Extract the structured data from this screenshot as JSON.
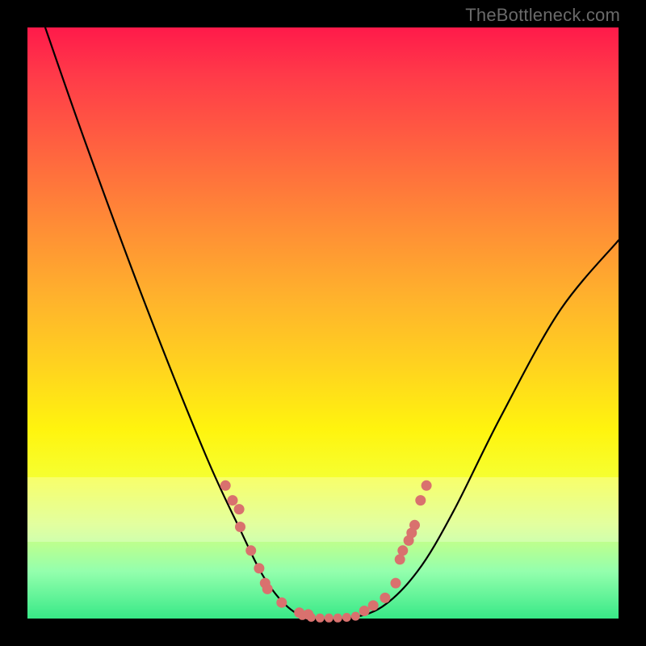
{
  "attribution": "TheBottleneck.com",
  "chart_data": {
    "type": "line",
    "title": "",
    "xlabel": "",
    "ylabel": "",
    "xlim": [
      0,
      100
    ],
    "ylim": [
      0,
      100
    ],
    "series": [
      {
        "name": "curve",
        "x": [
          3,
          10,
          20,
          30,
          36,
          40,
          44,
          48,
          54,
          60,
          66,
          72,
          80,
          90,
          100
        ],
        "y": [
          100,
          80,
          53,
          28,
          15,
          7,
          2,
          0,
          0,
          2,
          8,
          18,
          34,
          52,
          64
        ]
      }
    ],
    "markers": {
      "left_cluster": [
        {
          "x": 33.5,
          "y": 22.5
        },
        {
          "x": 34.7,
          "y": 20.0
        },
        {
          "x": 35.8,
          "y": 18.5
        },
        {
          "x": 36.0,
          "y": 15.5
        },
        {
          "x": 37.8,
          "y": 11.5
        },
        {
          "x": 39.2,
          "y": 8.5
        },
        {
          "x": 40.2,
          "y": 6.0
        },
        {
          "x": 40.6,
          "y": 5.0
        },
        {
          "x": 43.0,
          "y": 2.7
        },
        {
          "x": 46.0,
          "y": 1.0
        },
        {
          "x": 47.5,
          "y": 0.7
        }
      ],
      "bottom_cluster": [
        {
          "x": 46.5,
          "y": 0.5
        },
        {
          "x": 48.0,
          "y": 0.2
        },
        {
          "x": 49.5,
          "y": 0.1
        },
        {
          "x": 51.0,
          "y": 0.1
        },
        {
          "x": 52.5,
          "y": 0.1
        },
        {
          "x": 54.0,
          "y": 0.2
        },
        {
          "x": 55.5,
          "y": 0.4
        }
      ],
      "right_cluster": [
        {
          "x": 57.0,
          "y": 1.3
        },
        {
          "x": 58.5,
          "y": 2.2
        },
        {
          "x": 60.5,
          "y": 3.5
        },
        {
          "x": 62.3,
          "y": 6.0
        },
        {
          "x": 63.0,
          "y": 10.0
        },
        {
          "x": 63.5,
          "y": 11.5
        },
        {
          "x": 64.5,
          "y": 13.2
        },
        {
          "x": 65.0,
          "y": 14.5
        },
        {
          "x": 65.5,
          "y": 15.8
        },
        {
          "x": 66.5,
          "y": 20.0
        },
        {
          "x": 67.5,
          "y": 22.5
        }
      ]
    }
  }
}
